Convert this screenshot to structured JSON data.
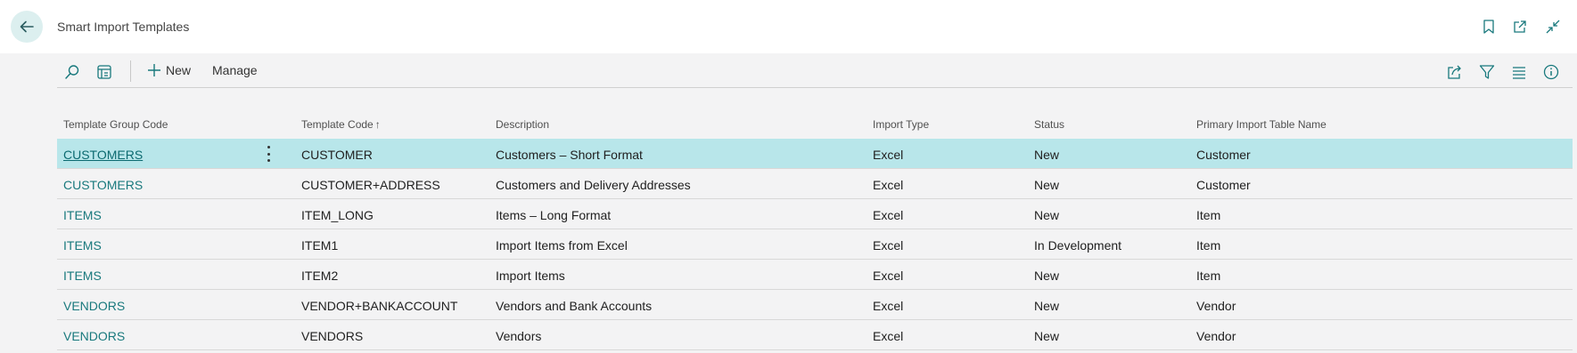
{
  "header": {
    "back_label": "Back",
    "title": "Smart Import Templates",
    "icons": [
      "bookmark-icon",
      "open-in-new-window-icon",
      "collapse-icon"
    ]
  },
  "actionbar": {
    "search_icon": "search-icon",
    "edit_list_icon": "edit-list-icon",
    "new_label": "New",
    "manage_label": "Manage",
    "right_icons": [
      "share-icon",
      "filter-icon",
      "list-view-icon",
      "info-icon"
    ]
  },
  "grid": {
    "columns": [
      "Template Group Code",
      "Template Code",
      "Description",
      "Import Type",
      "Status",
      "Primary Import Table Name"
    ],
    "sort_indicator": "↑",
    "rows": [
      [
        "CUSTOMERS",
        "CUSTOMER",
        "Customers – Short Format",
        "Excel",
        "New",
        "Customer"
      ],
      [
        "CUSTOMERS",
        "CUSTOMER+ADDRESS",
        "Customers and Delivery Addresses",
        "Excel",
        "New",
        "Customer"
      ],
      [
        "ITEMS",
        "ITEM_LONG",
        "Items – Long Format",
        "Excel",
        "New",
        "Item"
      ],
      [
        "ITEMS",
        "ITEM1",
        "Import Items from Excel",
        "Excel",
        "In Development",
        "Item"
      ],
      [
        "ITEMS",
        "ITEM2",
        "Import Items",
        "Excel",
        "New",
        "Item"
      ],
      [
        "VENDORS",
        "VENDOR+BANKACCOUNT",
        "Vendors and Bank Accounts",
        "Excel",
        "New",
        "Vendor"
      ],
      [
        "VENDORS",
        "VENDORS",
        "Vendors",
        "Excel",
        "New",
        "Vendor"
      ]
    ],
    "selected_row": 0
  },
  "colors": {
    "accent": "#19797d",
    "selected_row": "#b8e6ea",
    "back_button_bg": "#dcefef"
  }
}
